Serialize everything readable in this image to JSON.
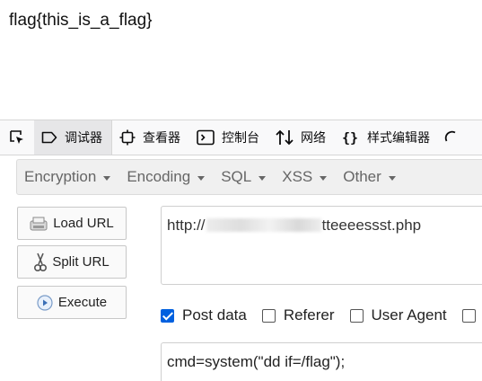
{
  "page": {
    "content_text": "flag{this_is_a_flag}"
  },
  "devtools": {
    "tabs": [
      {
        "label": "调试器",
        "icon": "debugger-icon",
        "active": true
      },
      {
        "label": "查看器",
        "icon": "inspector-icon"
      },
      {
        "label": "控制台",
        "icon": "console-icon"
      },
      {
        "label": "网络",
        "icon": "network-icon"
      },
      {
        "label": "样式编辑器",
        "icon": "style-editor-icon"
      }
    ]
  },
  "hackbar": {
    "menu": [
      {
        "label": "Encryption"
      },
      {
        "label": "Encoding"
      },
      {
        "label": "SQL"
      },
      {
        "label": "XSS"
      },
      {
        "label": "Other"
      }
    ],
    "buttons": {
      "load_url": "Load URL",
      "split_url": "Split URL",
      "execute": "Execute"
    },
    "url": {
      "prefix": "http://",
      "suffix": "tteeeessst.php"
    },
    "options": {
      "post_data": {
        "label": "Post data",
        "checked": true
      },
      "referer": {
        "label": "Referer",
        "checked": false
      },
      "user_agent": {
        "label": "User Agent",
        "checked": false
      }
    },
    "post_body": "cmd=system(\"dd if=/flag\");"
  }
}
